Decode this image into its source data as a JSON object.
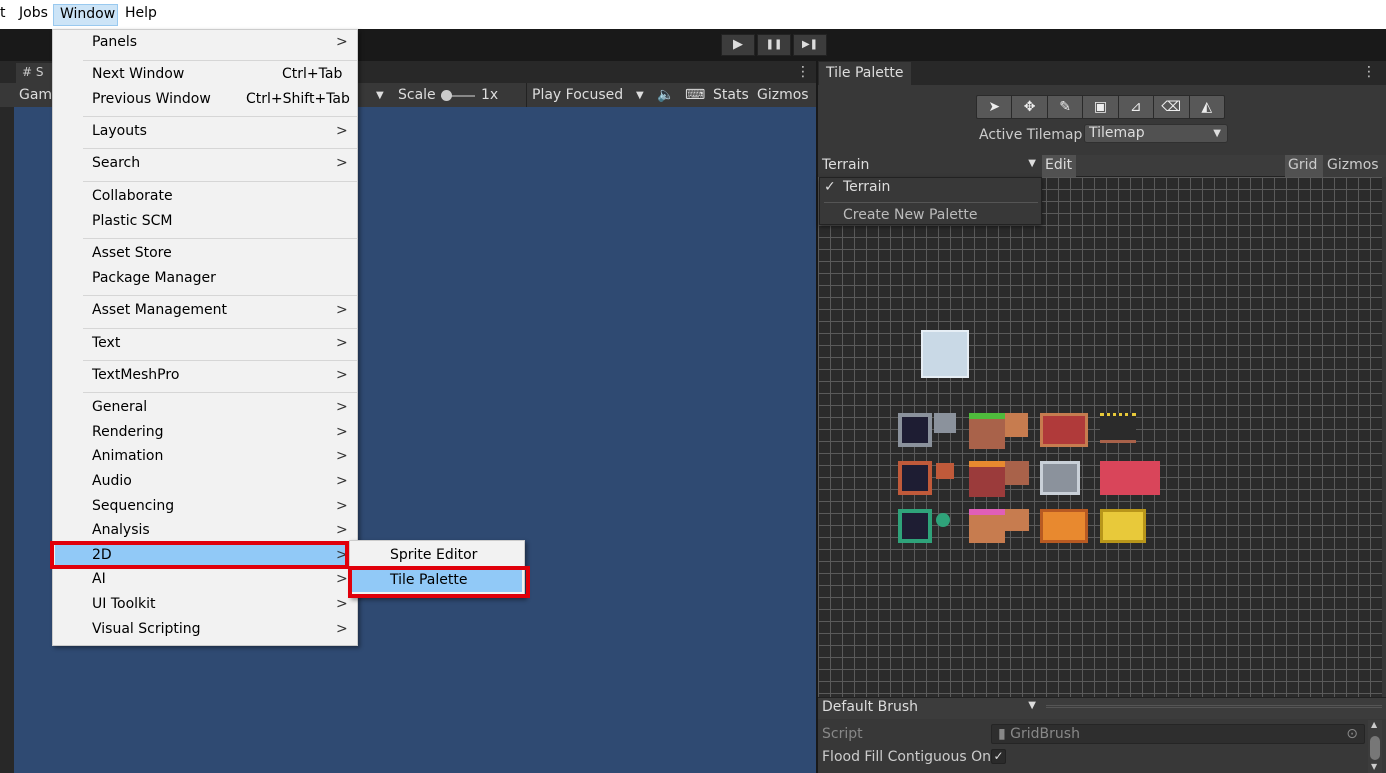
{
  "menubar": {
    "edit_fragment": "t",
    "jobs": "Jobs",
    "window": "Window",
    "help": "Help"
  },
  "toolbar": {
    "play": "▶",
    "pause": "❚❚",
    "step": "▶❚"
  },
  "scene_tab": {
    "label": "# S",
    "hash_icon": "grid-icon"
  },
  "game_bar": {
    "game_label": "Game",
    "scale_label": "Scale",
    "scale_value": "1x",
    "play_mode": "Play Focused",
    "stats": "Stats",
    "gizmos": "Gizmos"
  },
  "window_menu": {
    "groups": [
      [
        {
          "label": "Panels",
          "submenu": true
        }
      ],
      [
        {
          "label": "Next Window",
          "shortcut": "Ctrl+Tab"
        },
        {
          "label": "Previous Window",
          "shortcut": "Ctrl+Shift+Tab"
        }
      ],
      [
        {
          "label": "Layouts",
          "submenu": true
        }
      ],
      [
        {
          "label": "Search",
          "submenu": true
        }
      ],
      [
        {
          "label": "Collaborate"
        },
        {
          "label": "Plastic SCM"
        }
      ],
      [
        {
          "label": "Asset Store"
        },
        {
          "label": "Package Manager"
        }
      ],
      [
        {
          "label": "Asset Management",
          "submenu": true
        }
      ],
      [
        {
          "label": "Text",
          "submenu": true
        }
      ],
      [
        {
          "label": "TextMeshPro",
          "submenu": true
        }
      ],
      [
        {
          "label": "General",
          "submenu": true
        },
        {
          "label": "Rendering",
          "submenu": true
        },
        {
          "label": "Animation",
          "submenu": true
        },
        {
          "label": "Audio",
          "submenu": true
        },
        {
          "label": "Sequencing",
          "submenu": true
        },
        {
          "label": "Analysis",
          "submenu": true
        },
        {
          "label": "2D",
          "submenu": true,
          "highlighted": true
        },
        {
          "label": "AI",
          "submenu": true
        },
        {
          "label": "UI Toolkit",
          "submenu": true
        },
        {
          "label": "Visual Scripting",
          "submenu": true
        }
      ]
    ],
    "submenu_arrow": ">"
  },
  "submenu_2d": {
    "items": [
      {
        "label": "Sprite Editor"
      },
      {
        "label": "Tile Palette",
        "highlighted": true
      }
    ]
  },
  "tile_palette": {
    "tab_title": "Tile Palette",
    "tools": [
      "select-tool-icon",
      "move-tool-icon",
      "paint-brush-icon",
      "box-fill-icon",
      "picker-icon",
      "eraser-icon",
      "fill-bucket-icon"
    ],
    "active_tilemap_label": "Active Tilemap",
    "active_tilemap_value": "Tilemap",
    "palette_select": "Terrain",
    "edit": "Edit",
    "grid": "Grid",
    "gizmos": "Gizmos",
    "palette_dropdown": {
      "checked_item": "Terrain",
      "check": "✓",
      "create": "Create New Palette"
    },
    "brush_select": "Default Brush",
    "script_label": "Script",
    "script_value": "GridBrush",
    "flood_label": "Flood Fill Contiguous Only",
    "flood_checked": "✓"
  },
  "colors": {
    "highlight_box": "#e0000b",
    "menu_hover": "#91c9f7",
    "viewport": "#2f4a72"
  }
}
